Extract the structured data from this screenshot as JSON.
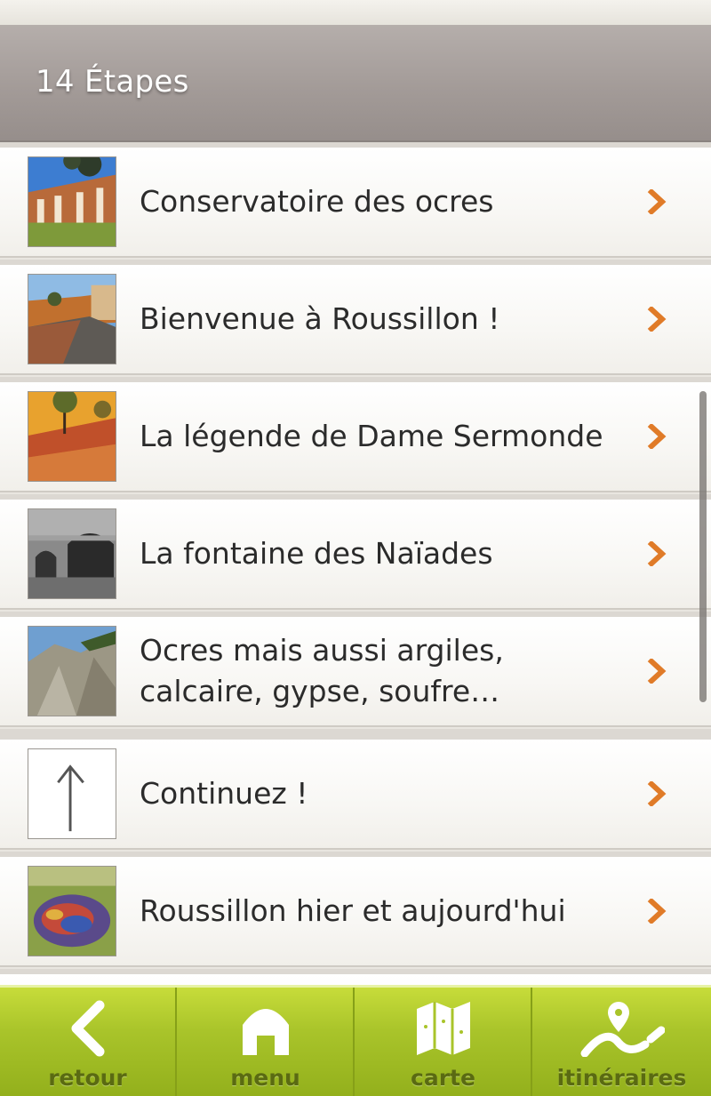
{
  "header": {
    "title": "14 Étapes"
  },
  "steps": [
    {
      "label": "Conservatoire des ocres",
      "thumb": "building-photo"
    },
    {
      "label": "Bienvenue à Roussillon !",
      "thumb": "village-street-photo"
    },
    {
      "label": "La légende de Dame Sermonde",
      "thumb": "ochre-cliff-photo"
    },
    {
      "label": "La fontaine des Naïades",
      "thumb": "fountain-bw-photo"
    },
    {
      "label": "Ocres mais aussi argiles, calcaire, gypse, soufre…",
      "thumb": "clay-hills-photo"
    },
    {
      "label": "Continuez !",
      "thumb": "arrow-up-icon"
    },
    {
      "label": "Roussillon hier et aujourd'hui",
      "thumb": "aerial-painting-photo"
    }
  ],
  "tabbar": {
    "back": "retour",
    "menu": "menu",
    "map": "carte",
    "routes": "itinéraires"
  },
  "colors": {
    "accent": "#e07b28",
    "header": "#a39b98",
    "tabbar": "#a9c42a"
  }
}
